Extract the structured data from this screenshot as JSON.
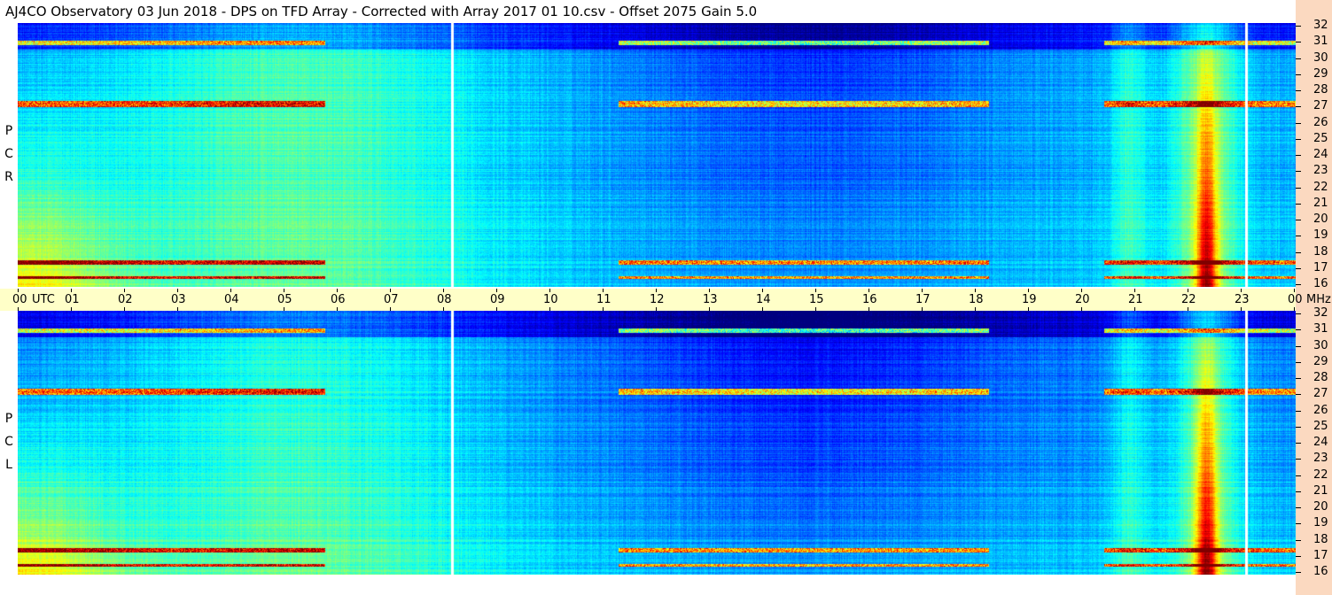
{
  "header": {
    "title": "AJ4CO Observatory  03 Jun 2018  -  DPS on TFD Array  -  Corrected with Array 2017 01 10.csv  -  Offset 2075  Gain 5.0"
  },
  "time_axis": {
    "label": "UTC",
    "hours": [
      "00",
      "01",
      "02",
      "03",
      "04",
      "05",
      "06",
      "07",
      "08",
      "09",
      "10",
      "11",
      "12",
      "13",
      "14",
      "15",
      "16",
      "17",
      "18",
      "19",
      "20",
      "21",
      "22",
      "23",
      "00"
    ]
  },
  "freq_axis": {
    "unit": "MHz",
    "labels": [
      "32",
      "31",
      "30",
      "29",
      "28",
      "27",
      "26",
      "25",
      "24",
      "23",
      "22",
      "21",
      "20",
      "19",
      "18",
      "17",
      "16"
    ]
  },
  "panels": {
    "top_polarization": [
      "R",
      "C",
      "P"
    ],
    "bottom_polarization": [
      "L",
      "C",
      "P"
    ]
  },
  "colors": {
    "background": "#ffffff",
    "utc_bar": "#ffffc8",
    "right_strip": "#fbd9c0"
  }
}
